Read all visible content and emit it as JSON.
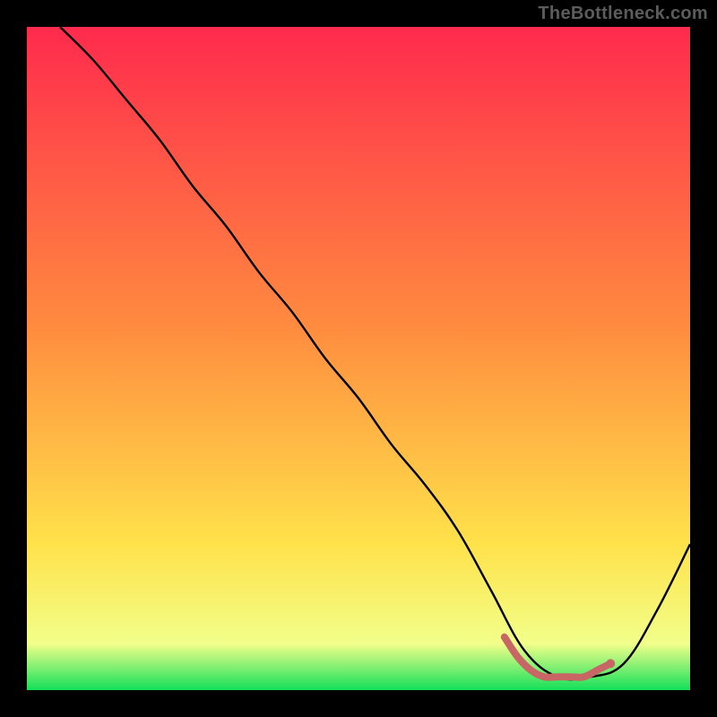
{
  "watermark": "TheBottleneck.com",
  "chart_data": {
    "type": "line",
    "title": "",
    "xlabel": "",
    "ylabel": "",
    "xlim": [
      0,
      100
    ],
    "ylim": [
      0,
      100
    ],
    "grid": false,
    "background_gradient": {
      "top": "#ff2a4d",
      "mid": "#ffe24a",
      "bottom": "#14e05a"
    },
    "series": [
      {
        "name": "bottleneck-curve",
        "stroke": "#000000",
        "x": [
          5,
          10,
          15,
          20,
          25,
          30,
          35,
          40,
          45,
          50,
          55,
          60,
          65,
          70,
          75,
          80,
          85,
          90,
          95,
          100
        ],
        "values": [
          100,
          95,
          89,
          83,
          76,
          70,
          63,
          57,
          50,
          44,
          37,
          31,
          24,
          15,
          6,
          2,
          2,
          4,
          12,
          22
        ]
      },
      {
        "name": "highlight-band",
        "stroke": "#c86565",
        "x": [
          72,
          74,
          76,
          78,
          80,
          82,
          84,
          86,
          88
        ],
        "values": [
          8,
          5,
          3,
          2,
          2,
          2,
          2,
          3,
          4
        ]
      }
    ]
  }
}
